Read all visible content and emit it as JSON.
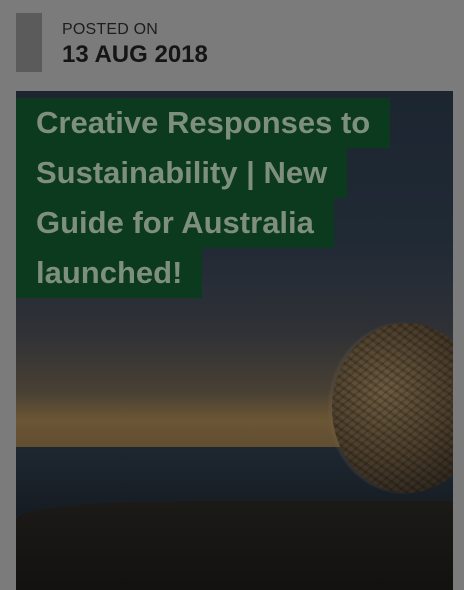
{
  "post": {
    "posted_label": "POSTED ON",
    "posted_date": "13 AUG 2018",
    "title_lines": [
      "Creative Responses to",
      "Sustainability | New",
      "Guide for Australia",
      "launched!"
    ]
  },
  "colors": {
    "overlay_background": "#7b7b7b",
    "title_background": "#0b3a1f",
    "title_text": "#7f8f7d"
  },
  "hero_image": {
    "icon": "sunset-sphere-sculpture-image"
  }
}
